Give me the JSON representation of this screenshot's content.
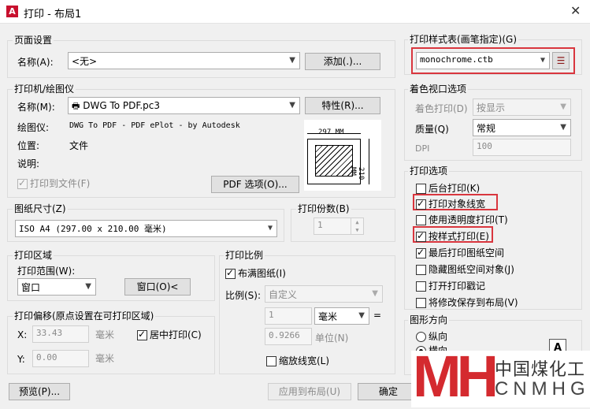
{
  "window": {
    "title": "打印 - 布局1",
    "app_icon_letter": "A",
    "close_glyph": "✕"
  },
  "page_setup": {
    "title": "页面设置",
    "name_label": "名称(A):",
    "name_value": "<无>",
    "add_button": "添加(.)..."
  },
  "printer": {
    "title": "打印机/绘图仪",
    "name_label": "名称(M):",
    "name_value": "DWG To PDF.pc3",
    "properties_button": "特性(R)...",
    "plotter_label": "绘图仪:",
    "plotter_value": "DWG To PDF - PDF ePlot - by Autodesk",
    "location_label": "位置:",
    "location_value": "文件",
    "description_label": "说明:",
    "print_to_file": "打印到文件(F)",
    "pdf_options_button": "PDF 选项(O)...",
    "preview_width": "297 MM",
    "preview_height": "210 MM"
  },
  "paper_size": {
    "title": "图纸尺寸(Z)",
    "value": "ISO A4 (297.00 x 210.00 毫米)"
  },
  "copies": {
    "title": "打印份数(B)",
    "value": "1"
  },
  "print_area": {
    "title": "打印区域",
    "range_label": "打印范围(W):",
    "range_value": "窗口",
    "window_button": "窗口(O)<"
  },
  "print_offset": {
    "title": "打印偏移(原点设置在可打印区域)",
    "x_label": "X:",
    "x_value": "33.43",
    "x_unit": "毫米",
    "y_label": "Y:",
    "y_value": "0.00",
    "y_unit": "毫米",
    "center": "居中打印(C)"
  },
  "print_scale": {
    "title": "打印比例",
    "fit_paper": "布满图纸(I)",
    "scale_label": "比例(S):",
    "scale_value": "自定义",
    "value1": "1",
    "unit_value": "毫米",
    "equals": "=",
    "value2": "0.9266",
    "unit_label": "单位(N)",
    "scale_lineweights": "缩放线宽(L)"
  },
  "plot_style": {
    "title": "打印样式表(画笔指定)(G)",
    "value": "monochrome.ctb",
    "edit_icon": "☰"
  },
  "shaded_viewport": {
    "title": "着色视口选项",
    "shade_label": "着色打印(D)",
    "shade_value": "按显示",
    "quality_label": "质量(Q)",
    "quality_value": "常规",
    "dpi_label": "DPI",
    "dpi_value": "100"
  },
  "plot_options": {
    "title": "打印选项",
    "items": [
      {
        "label": "后台打印(K)",
        "checked": false
      },
      {
        "label": "打印对象线宽",
        "checked": true
      },
      {
        "label": "使用透明度打印(T)",
        "checked": false
      },
      {
        "label": "按样式打印(E)",
        "checked": true
      },
      {
        "label": "最后打印图纸空间",
        "checked": true
      },
      {
        "label": "隐藏图纸空间对象(J)",
        "checked": false
      },
      {
        "label": "打开打印戳记",
        "checked": false
      },
      {
        "label": "将修改保存到布局(V)",
        "checked": false
      }
    ]
  },
  "orientation": {
    "title": "图形方向",
    "portrait": "纵向",
    "landscape": "横向",
    "icon_letter": "A"
  },
  "bottom": {
    "preview_button": "预览(P)...",
    "apply_button": "应用到布局(U)",
    "ok_button": "确定"
  },
  "watermark": {
    "logo": "MH",
    "cn": "中国煤化工",
    "en": "CNMHG"
  },
  "colors": {
    "highlight": "#d9363e",
    "logo_red": "#d42a2f"
  }
}
